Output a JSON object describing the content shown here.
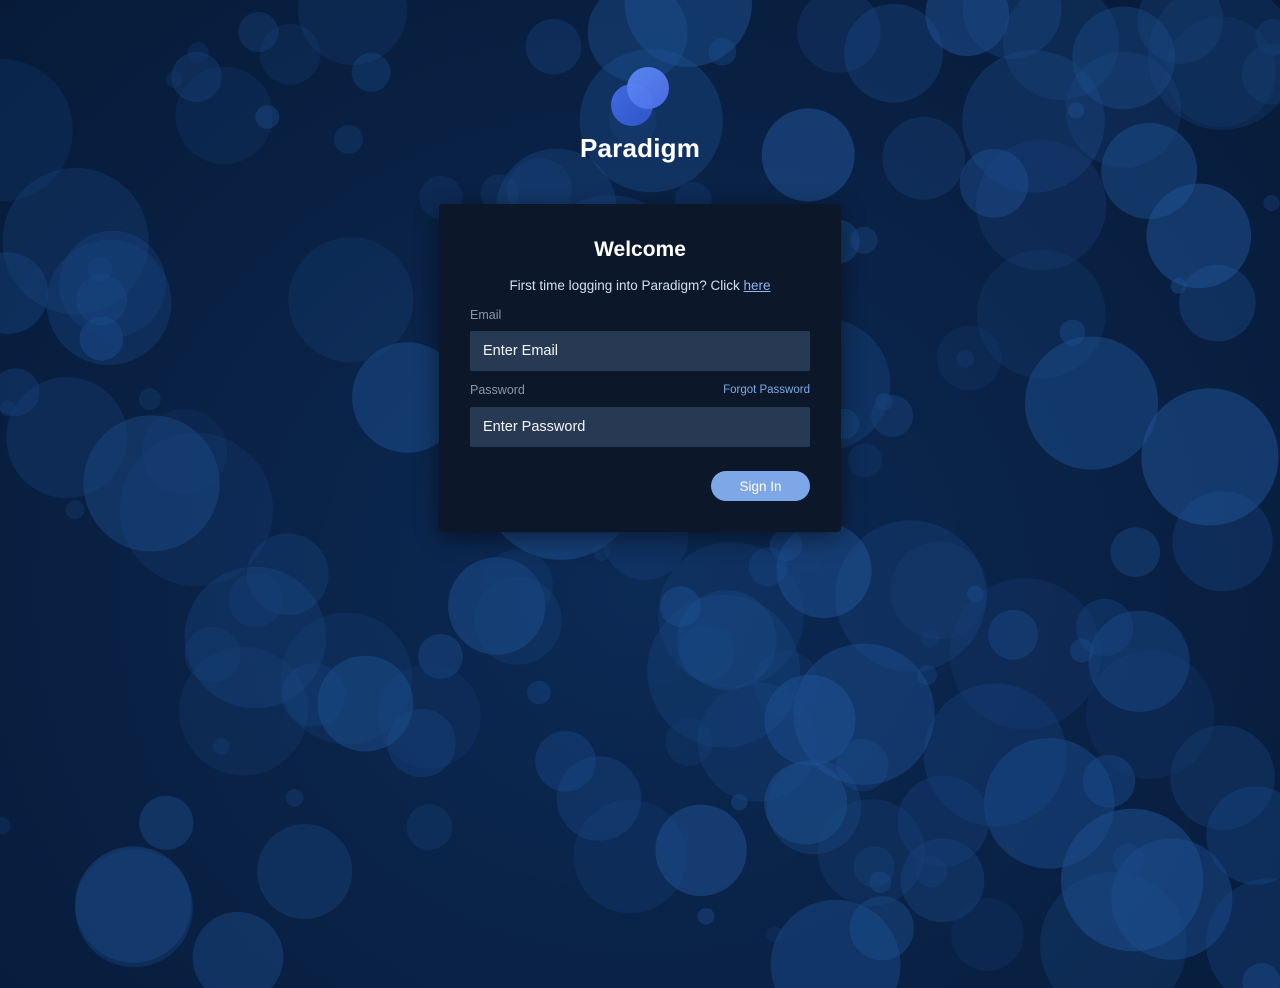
{
  "brand": {
    "name": "Paradigm",
    "logo_icon": "paradigm-logo-icon",
    "accent_color": "#4f7df0"
  },
  "login": {
    "title": "Welcome",
    "subtitle_text": "First time logging into Paradigm? Click ",
    "subtitle_link": "here",
    "email_label": "Email",
    "email_placeholder": "Enter Email",
    "email_value": "",
    "password_label": "Password",
    "password_placeholder": "Enter Password",
    "password_value": "",
    "forgot_label": "Forgot Password",
    "signin_label": "Sign In"
  },
  "colors": {
    "background": "#0a2348",
    "card": "#0c1729",
    "input": "#283954",
    "button": "#7da7e6",
    "link": "#8fb6f0"
  }
}
